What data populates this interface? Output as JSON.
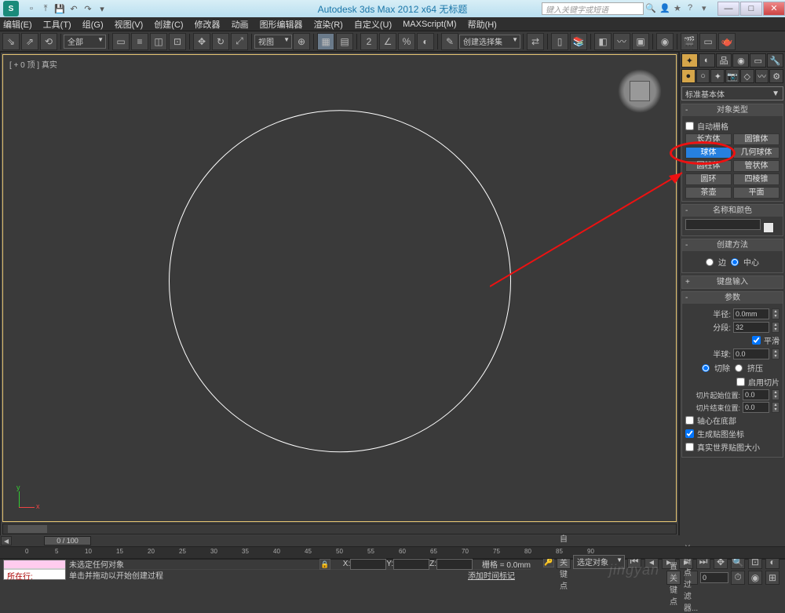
{
  "title": "Autodesk 3ds Max  2012  x64   无标题",
  "search_placeholder": "键入关键字或短语",
  "menu": [
    "编辑(E)",
    "工具(T)",
    "组(G)",
    "视图(V)",
    "创建(C)",
    "修改器",
    "动画",
    "图形编辑器",
    "渲染(R)",
    "自定义(U)",
    "MAXScript(M)",
    "帮助(H)"
  ],
  "tool_all": "全部",
  "tool_view": "视图",
  "tool_selset": "创建选择集",
  "viewport_label": "[ + 0 顶 ] 真实",
  "cmd_dropdown": "标准基本体",
  "rollout_objtype": "对象类型",
  "autogrid": "自动栅格",
  "objects": [
    [
      "长方体",
      "圆锥体"
    ],
    [
      "球体",
      "几何球体"
    ],
    [
      "圆柱体",
      "管状体"
    ],
    [
      "圆环",
      "四棱锥"
    ],
    [
      "茶壶",
      "平面"
    ]
  ],
  "rollout_namecolor": "名称和颜色",
  "rollout_method": "创建方法",
  "method_edge": "边",
  "method_center": "中心",
  "rollout_keyboard": "键盘输入",
  "rollout_params": "参数",
  "param_radius": "半径:",
  "param_radius_val": "0.0mm",
  "param_segs": "分段:",
  "param_segs_val": "32",
  "param_smooth": "平滑",
  "param_hemi": "半球:",
  "param_hemi_val": "0.0",
  "param_chop": "切除",
  "param_squash": "挤压",
  "param_slice_on": "启用切片",
  "param_slice_from": "切片起始位置:",
  "param_slice_to": "切片结束位置:",
  "param_slice_val": "0.0",
  "param_base": "轴心在底部",
  "param_genmap": "生成贴图坐标",
  "param_realworld": "真实世界贴图大小",
  "time_handle": "0 / 100",
  "ruler_ticks": [
    "0",
    "5",
    "10",
    "15",
    "20",
    "25",
    "30",
    "35",
    "40",
    "45",
    "50",
    "55",
    "60",
    "65",
    "70",
    "75",
    "80",
    "85",
    "90"
  ],
  "status_nosel": "未选定任何对象",
  "status_hint": "单击并拖动以开始创建过程",
  "status_addtime": "添加时间标记",
  "coord_x": "X:",
  "coord_y": "Y:",
  "coord_z": "Z:",
  "grid_label": "栅格 = 0.0mm",
  "autokey": "自动关键点",
  "setkey": "设置关键点",
  "selobj": "选定对象",
  "keyfilter": "关键点过滤器...",
  "prompt_tab": "所在行:",
  "watermark": "jingyan"
}
